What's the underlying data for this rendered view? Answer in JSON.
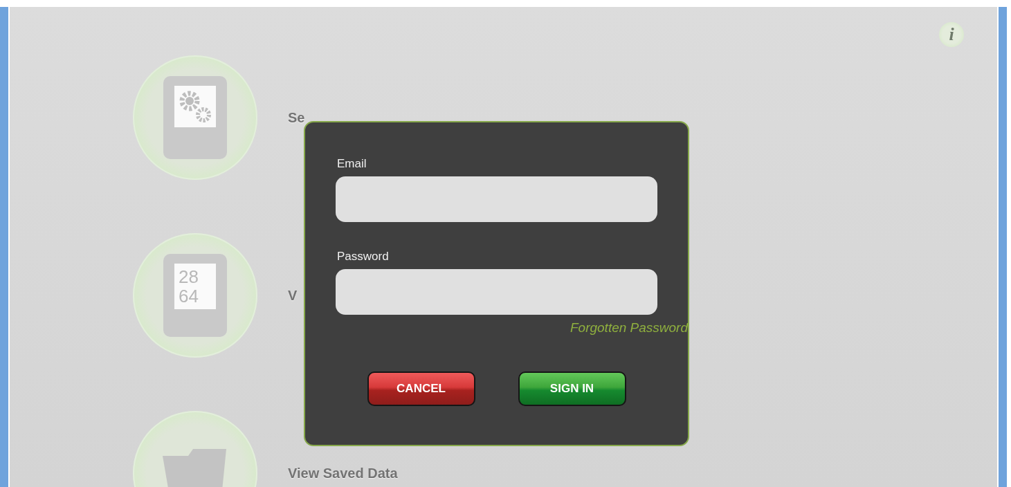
{
  "menu": [
    {
      "kind": "settings",
      "label": "Se"
    },
    {
      "kind": "readings",
      "label": "V",
      "display_lines": [
        "28",
        "64"
      ]
    },
    {
      "kind": "folder",
      "label": "View Saved Data"
    }
  ],
  "info_button": "i",
  "login_dialog": {
    "fields": [
      {
        "label": "Email"
      },
      {
        "label": "Password"
      }
    ],
    "forgot_link": "Forgotten Password",
    "buttons": [
      {
        "label": "CANCEL",
        "kind": "cancel"
      },
      {
        "label": "SIGN IN",
        "kind": "primary"
      }
    ]
  }
}
